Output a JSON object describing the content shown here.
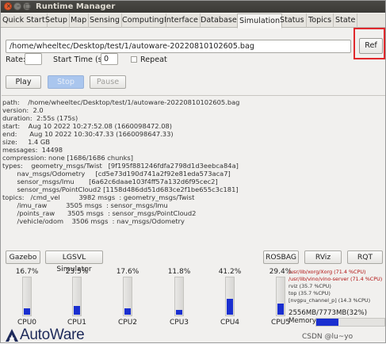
{
  "window": {
    "title": "Runtime Manager",
    "accent": "#e0282c"
  },
  "tabs": [
    "Quick Start",
    "Setup",
    "Map",
    "Sensing",
    "Computing",
    "Interface",
    "Database",
    "Simulation",
    "Status",
    "Topics",
    "State"
  ],
  "active_tab": "Simulation",
  "rosbag": {
    "path": "/home/wheeltec/Desktop/test/1/autoware-20220810102605.bag",
    "ref_label": "Ref",
    "rate_label": "Rate:",
    "rate_value": "",
    "start_time_label": "Start Time (s):",
    "start_time_value": "0",
    "repeat_label": "Repeat",
    "repeat_checked": false,
    "play_label": "Play",
    "stop_label": "Stop",
    "pause_label": "Pause"
  },
  "bag_info": {
    "path": "path:    /home/wheeltec/Desktop/test/1/autoware-20220810102605.bag",
    "version": "version:  2.0",
    "duration": "duration:  2:55s (175s)",
    "start": "start:    Aug 10 2022 10:27:52.08 (1660098472.08)",
    "end": "end:      Aug 10 2022 10:30:47.33 (1660098647.33)",
    "size": "size:     1.4 GB",
    "messages": "messages:  14498",
    "compression": "compression: none [1686/1686 chunks]",
    "types_1": "types:    geometry_msgs/Twist   [9f195f881246fdfa2798d1d3eebca84a]",
    "types_2": "       nav_msgs/Odometry     [cd5e73d190d741a2f92e81eda573aca7]",
    "types_3": "       sensor_msgs/Imu       [6a62c6daae103f4ff57a132d6f95cec2]",
    "types_4": "       sensor_msgs/PointCloud2 [1158d486dd51d683ce2f1be655c3c181]",
    "topics_1": "topics:   /cmd_vel         3982 msgs  : geometry_msgs/Twist",
    "topics_2": "       /imu_raw         3505 msgs  : sensor_msgs/Imu",
    "topics_3": "       /points_raw      3505 msgs  : sensor_msgs/PointCloud2",
    "topics_4": "       /vehicle/odom    3506 msgs  : nav_msgs/Odometry"
  },
  "bottom_buttons": {
    "gazebo": "Gazebo",
    "lgsvl": "LGSVL Simulator",
    "rosbag": "ROSBAG",
    "rviz": "RViz",
    "rqt": "RQT"
  },
  "cpus": [
    {
      "name": "CPU0",
      "pct_label": "16.7%",
      "value": 16.7
    },
    {
      "name": "CPU1",
      "pct_label": "23.5%",
      "value": 23.5
    },
    {
      "name": "CPU2",
      "pct_label": "17.6%",
      "value": 17.6
    },
    {
      "name": "CPU3",
      "pct_label": "11.8%",
      "value": 11.8
    },
    {
      "name": "CPU4",
      "pct_label": "41.2%",
      "value": 41.2
    },
    {
      "name": "CPU5",
      "pct_label": "29.4%",
      "value": 29.4
    }
  ],
  "processes": [
    "/usr/lib/xorg/Xorg (71.4 %CPU)",
    "/usr/lib/vino/vino-server (71.4 %CPU)",
    "rviz (35.7 %CPU)",
    "top (35.7 %CPU)",
    "[nvgpu_channel_p] (14.3 %CPU)"
  ],
  "memory": {
    "usage_text": "2556MB/7773MB(32%)",
    "label": "Memory",
    "fraction": 0.32
  },
  "logo_text": "AutoWare",
  "watermark": "CSDN @lu~yo",
  "bar_color": "#1a2fd0"
}
